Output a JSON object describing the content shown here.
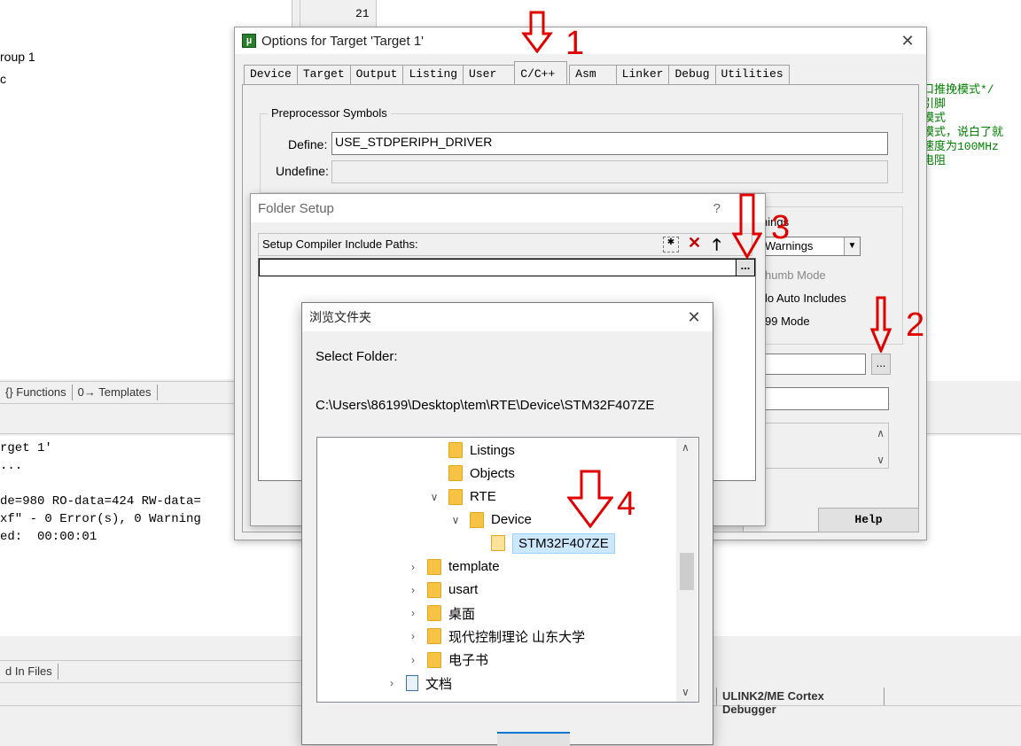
{
  "ide": {
    "project_items": [
      "roup 1",
      "c"
    ],
    "left_tabs": [
      "{} Functions",
      "0→ Templates"
    ],
    "build_output": [
      "rget 1'",
      "...",
      "de=980 RO-data=424 RW-data=",
      "xf\" - 0 Error(s), 0 Warning",
      "ed:  00:00:01"
    ],
    "bottom_tab": "d In Files",
    "line_number": "21",
    "code_comments": [
      "口推挽模式*/",
      "引脚",
      "模式",
      "模式，说白了就",
      "速度为100MHz",
      "电阻"
    ],
    "status_debugger": "ULINK2/ME Cortex Debugger"
  },
  "options_dialog": {
    "title": "Options for Target 'Target 1'",
    "tabs": [
      "Device",
      "Target",
      "Output",
      "Listing",
      "User",
      "C/C++",
      "Asm",
      "Linker",
      "Debug",
      "Utilities"
    ],
    "selected_tab": "C/C++",
    "preprocessor_legend": "Preprocessor Symbols",
    "define_label": "Define:",
    "define_value": "USE_STDPERIPH_DRIVER",
    "undefine_label": "Undefine:",
    "warnings_label": "nings",
    "warnings_value": "Warnings",
    "thumb_mode": "humb Mode",
    "no_auto_includes": "lo Auto Includes",
    "c99_mode": "99 Mode",
    "help_label": "Help",
    "browse_label": "..."
  },
  "folder_setup": {
    "title": "Folder Setup",
    "help_glyph": "?",
    "setup_label": "Setup Compiler Include Paths:",
    "browse_label": "..."
  },
  "browse_dialog": {
    "title": "浏览文件夹",
    "select_label": "Select Folder:",
    "path": "C:\\Users\\86199\\Desktop\\tem\\RTE\\Device\\STM32F407ZE",
    "tree": [
      {
        "label": "Listings",
        "chevron": "",
        "indent": 2
      },
      {
        "label": "Objects",
        "chevron": "",
        "indent": 2
      },
      {
        "label": "RTE",
        "chevron": "∨",
        "indent": 2
      },
      {
        "label": "Device",
        "chevron": "∨",
        "indent": 3
      },
      {
        "label": "STM32F407ZE",
        "chevron": "",
        "indent": 4,
        "selected": true
      },
      {
        "label": "template",
        "chevron": "›",
        "indent": 1
      },
      {
        "label": "usart",
        "chevron": "›",
        "indent": 1
      },
      {
        "label": "桌面",
        "chevron": "›",
        "indent": 1
      },
      {
        "label": "现代控制理论 山东大学",
        "chevron": "›",
        "indent": 1
      },
      {
        "label": "电子书",
        "chevron": "›",
        "indent": 1
      },
      {
        "label": "文档",
        "chevron": "›",
        "indent": 0,
        "doc": true
      }
    ]
  },
  "annotations": [
    "1",
    "2",
    "3",
    "4"
  ],
  "colors": {
    "annotation": "#e00000",
    "selection": "#cce8ff",
    "folder": "#f6c344",
    "code_comment": "#008000"
  }
}
